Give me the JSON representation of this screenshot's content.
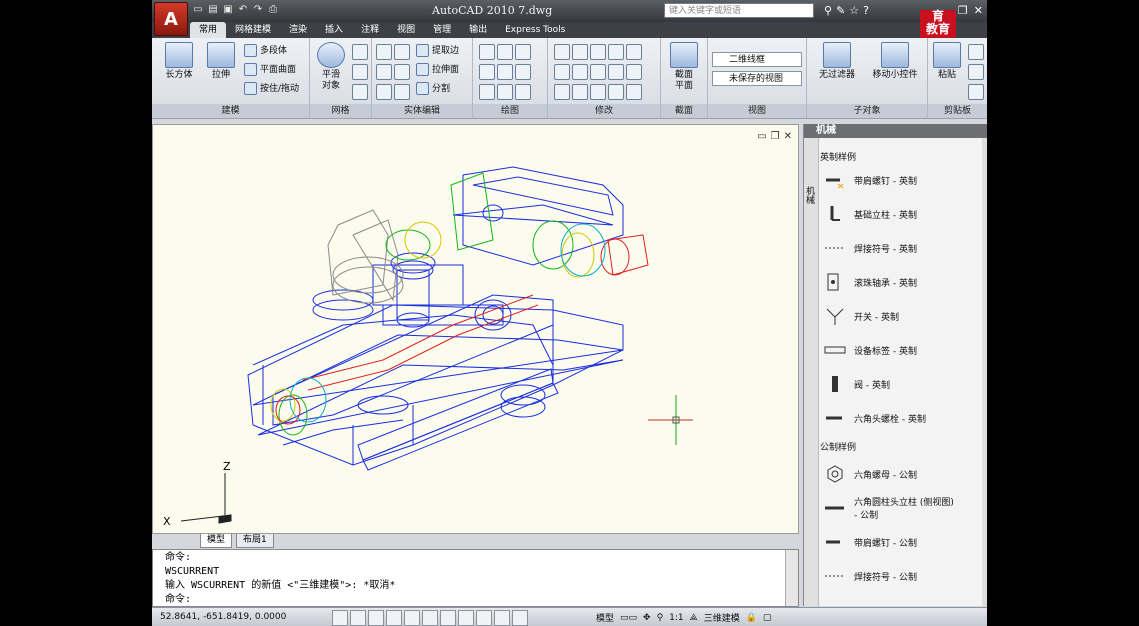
{
  "title_bar": {
    "title": "AutoCAD 2010   7.dwg",
    "search_placeholder": "键入关键字或短语",
    "brand_line1": "育",
    "brand_line2": "教育",
    "qat_icons": [
      "new-icon",
      "open-icon",
      "save-icon",
      "undo-icon",
      "redo-icon",
      "plot-icon"
    ]
  },
  "tabs": [
    "常用",
    "网格建模",
    "渲染",
    "插入",
    "注释",
    "视图",
    "管理",
    "输出",
    "Express Tools"
  ],
  "active_tab": "常用",
  "ribbon": {
    "modeling": {
      "title": "建模",
      "box": "长方体",
      "extrude": "拉伸",
      "polysolid": "多段体",
      "planar": "平面曲面",
      "presspull": "按住/拖动"
    },
    "mesh": {
      "title": "网格",
      "smooth": "平滑\n对象"
    },
    "solid_edit": {
      "title": "实体编辑",
      "extract": "提取边",
      "extrude_face": "拉伸面",
      "separate": "分割"
    },
    "draw": {
      "title": "绘图"
    },
    "modify": {
      "title": "修改"
    },
    "section": {
      "title": "截面",
      "plane": "截面\n平面"
    },
    "view": {
      "title": "视图",
      "visual_style": "二维线框",
      "saved_view": "未保存的视图"
    },
    "subobject": {
      "title": "子对象",
      "no_filter": "无过滤器",
      "gizmo": "移动小控件"
    },
    "clipboard": {
      "title": "剪贴板",
      "paste": "粘贴"
    }
  },
  "model_tabs": [
    "模型",
    "布局1"
  ],
  "palette": {
    "title": "机械",
    "side_label": "机械",
    "section1": "英制样例",
    "items1": [
      "带肩螺钉 - 英制",
      "基础立柱 - 英制",
      "焊接符号 - 英制",
      "滚珠轴承 - 英制",
      "开关 - 英制",
      "设备标签 - 英制",
      "阀 - 英制",
      "六角头螺栓 - 英制"
    ],
    "section2": "公制样例",
    "items2": [
      "六角螺母 - 公制",
      "六角圆柱头立柱 (侧视图)\n- 公制",
      "带肩螺钉 - 公制",
      "焊接符号 - 公制"
    ]
  },
  "command": {
    "lines": [
      "命令:",
      "WSCURRENT",
      "输入 WSCURRENT 的新值 <\"三维建模\">: *取消*",
      "命令:"
    ]
  },
  "status": {
    "coords": "52.8641,  -651.8419, 0.0000",
    "model": "模型",
    "scale": "1:1",
    "workspace": "三维建模"
  },
  "ucs": {
    "x_label": "X",
    "z_label": "Z"
  }
}
